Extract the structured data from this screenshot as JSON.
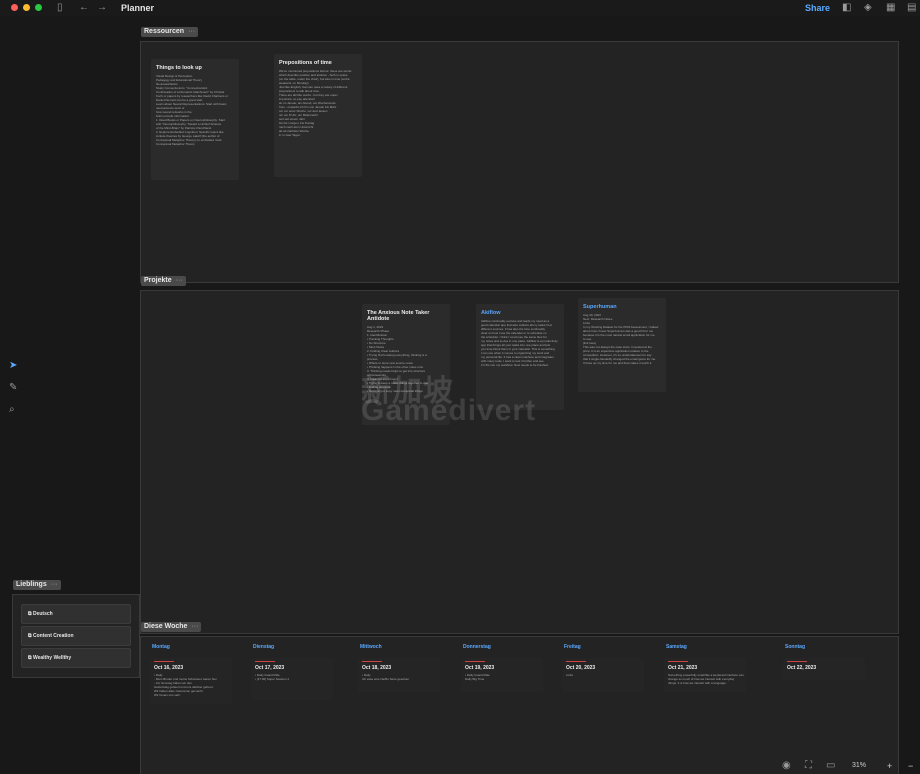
{
  "window": {
    "title": "Planner",
    "share_label": "Share"
  },
  "groups": {
    "ressourcen": {
      "label": "Ressourcen",
      "more": "···"
    },
    "projekte": {
      "label": "Projekte",
      "more": "···"
    },
    "lieblings": {
      "label": "Lieblings",
      "more": "···"
    },
    "diese_woche": {
      "label": "Diese Woche",
      "more": "···"
    }
  },
  "resource_cards": [
    {
      "title": "Things to look up",
      "lines": [
        "Visual Design & Perception",
        "Pedagogy and Educational Theory",
        "Neuroaesthetics",
        "  Study Connectionism: \"Connectionistic",
        "  Continuation of a Romantic Attachment\" by Christof",
        "  Koch or papers by researchers like David Chalmers or",
        "  Daniel Dennett can be a good start.",
        "Learn about Neural Representations: Start with basic",
        "neuroscience texts or",
        "how neural networks in the",
        "brain encode information.",
        "  1. Read Books or Papers on Neurophilosophy: Start",
        "     with \"Neurophilosophy: Toward a Unified Science",
        "     of the Mind-Brain\" by Patricia Churchland.",
        "  2. Explore Embodied Cognition: Specific topics like",
        "     include theories by George Lakoff (the author of",
        "     Conceptual Metaphor Theory) on embodied mind.",
        "",
        "Conceptual Metaphor Theory"
      ]
    },
    {
      "title": "Prepositions of time",
      "lines": [
        "We've mentioned prepositions before: these are words",
        "which describe position and location - both in space",
        "(on the table, under the chair), but also in time (at the",
        "weekend, on Monday).",
        "Just like English, German uses a variety of different",
        "prepositions to talk about time.",
        "There are all little words - but they are super",
        "important, so pay attention!",
        "",
        "an       im Januar, am Abend, am Wochenende",
        "from...onwards   Ich bin von Januar bis März",
        "",
        "vor      vor einer Woche, vor dem Essen",
        "",
        "um       um 8 Uhr, um Mitternacht",
        "",
        "seit     seit einem Jahr",
        "",
        "bis      bis morgen, bis Freitag",
        "nach     nach dem Unterricht",
        "ab       ab nächster Woche",
        "in       in zwei Tagen"
      ]
    }
  ],
  "project_cards": [
    {
      "title": "The Anxious Note Taker Antidote",
      "lines": [
        "Aug 1, 2023",
        "Research Phase",
        "",
        "1. Identification",
        "   • Tracking Thoughts",
        "   • No Structure",
        "   • Slow Notes",
        "2. Finding Clear Authors",
        "   • Trying first knowing everything, thinking is a",
        "     process",
        "   • Where to store new source notes",
        "   • Thinking happens in the other notes now",
        "3. Thinking needs helps to get into structure",
        "   of frameworks",
        "4. Ideas for experiment",
        "   • Trying to keep a notes things together in one",
        "   • Ending structure",
        "   • Not trying to copy new conceptual things"
      ]
    },
    {
      "title": "Akiflow",
      "lines": [
        "Akiflow continually evolves and leads my need as a",
        "good calendar app that also collects all my tasks from",
        "different sources. It has also the time continually",
        "clear on how I use the calendar or to schedule on",
        "the schedule. I think I could use the same flow for",
        "my notes and to-dos in one place. Akiflow is a productivity",
        "app that brings all your tasks into one place and lets",
        "you time-block them in your calendar. This is something",
        "I can use when it comes to organizing my work and",
        "my personal life. It has a clean interface and integrates",
        "with many tools. I want to test it further and see",
        "if it fits into my workflow. Now needs to be finished."
      ]
    },
    {
      "title": "Superhuman",
      "lines": [
        "Aug 30, 2023",
        "Next: Research Notes",
        "Links",
        "",
        "In my Working Dataset for the PKM Assessment, I talked",
        "about how I know Superhuman was a good fit for me",
        "because it is the most natural email application for me",
        "to use.",
        "[link here]",
        "",
        "This was not always the case since I invested at the",
        "price. It is an expensive application relative to the",
        "competition. However, it's so understatement to say",
        "that it single-handedly changed the email game for me.",
        "It frees up my time for me and that makes it worth it."
      ]
    }
  ],
  "favorites": [
    {
      "label": "Deutsch"
    },
    {
      "label": "Content Creation"
    },
    {
      "label": "Wealthy Wellthy"
    }
  ],
  "week": [
    {
      "day": "Montag",
      "date": "Oct 16, 2023",
      "lines": [
        "• Daily",
        "   ◦ Mein Bruder und meine Schwester waren hier",
        "   ◦ Am Sonntag haben wir den",
        "     Geburtstag gefeiert und uns darüber gefreut.",
        "     Wir haben alles zusammen gemacht.",
        "     Wir freuen uns sehr."
      ]
    },
    {
      "day": "Dienstag",
      "date": "Oct 17, 2023",
      "lines": [
        "• Daily Guard Ride",
        "",
        "",
        "",
        "• [17:30] Super Session 4"
      ]
    },
    {
      "day": "Mittwoch",
      "date": "Oct 18, 2023",
      "lines": [
        "• Daily",
        "   Ich esse eine Netflix Serie gesehen"
      ]
    },
    {
      "day": "Donnerstag",
      "date": "Oct 19, 2023",
      "lines": [
        "• Daily Guard Ride",
        "   Daily Big Time"
      ]
    },
    {
      "day": "Freitag",
      "date": "Oct 20, 2023",
      "lines": [
        "Links"
      ]
    },
    {
      "day": "Samstag",
      "date": "Oct 21, 2023",
      "lines": [
        "Something powerfully small like a keyboard interface can",
        "change so much of how we interact with everyday",
        "things. It is how we interact with a language."
      ]
    },
    {
      "day": "Sonntag",
      "date": "Oct 22, 2023",
      "lines": []
    }
  ],
  "zoom": {
    "level": "31%",
    "minus": "−",
    "plus": "+"
  },
  "watermark": {
    "line1": "新加坡",
    "line2": "Gamedivert"
  },
  "colors": {
    "accent": "#5aa9ff",
    "background": "#181818",
    "group_bg": "#232323"
  }
}
